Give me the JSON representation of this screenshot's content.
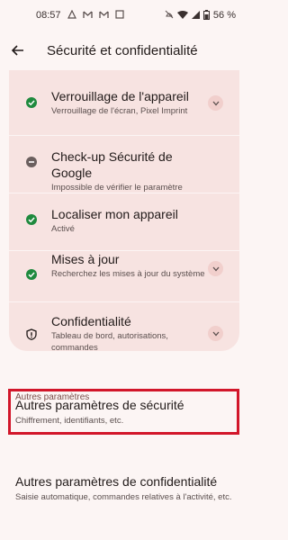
{
  "status": {
    "time": "08:57",
    "battery": "56 %"
  },
  "appbar": {
    "title": "Sécurité et confidentialité"
  },
  "rows": [
    {
      "title": "Verrouillage de l'appareil",
      "sub": "Verrouillage de l'écran, Pixel Imprint",
      "icon": "check-circle-icon",
      "expandable": true
    },
    {
      "title": "Check-up Sécurité de Google",
      "sub": "Impossible de vérifier le paramètre",
      "icon": "minus-circle-icon",
      "expandable": false
    },
    {
      "title": "Localiser mon appareil",
      "sub": "Activé",
      "icon": "check-circle-icon",
      "expandable": false
    },
    {
      "title": "Mises à jour",
      "sub": "Recherchez les mises à jour du système",
      "icon": "check-circle-icon",
      "expandable": true
    },
    {
      "title": "Confidentialité",
      "sub": "Tableau de bord, autorisations, commandes",
      "icon": "shield-icon",
      "expandable": true
    }
  ],
  "other_section": {
    "label": "Autres paramètres",
    "items": [
      {
        "title": "Autres paramètres de sécurité",
        "sub": "Chiffrement, identifiants, etc."
      },
      {
        "title": "Autres paramètres de confidentialité",
        "sub": "Saisie automatique, commandes relatives à l'activité, etc."
      }
    ]
  },
  "colors": {
    "accent_check": "#1f8a3e",
    "highlight": "#d2162a",
    "card": "#f7e3e1"
  }
}
